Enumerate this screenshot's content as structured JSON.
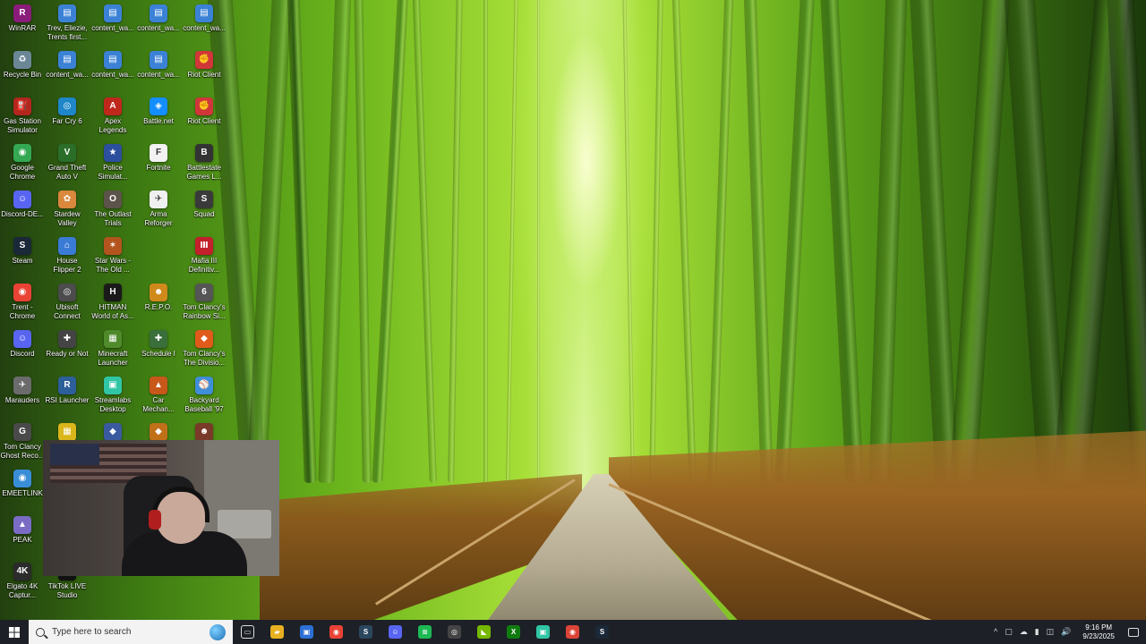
{
  "desktop": {
    "icons": [
      {
        "label": "WinRAR",
        "glyph": "R",
        "color": "#8a1c7a"
      },
      {
        "label": "Trev, Eliezie,\nTrents first...",
        "glyph": "▤",
        "color": "#3b82d6"
      },
      {
        "label": "content_wa...",
        "glyph": "▤",
        "color": "#3b82d6"
      },
      {
        "label": "content_wa...",
        "glyph": "▤",
        "color": "#3b82d6"
      },
      {
        "label": "content_wa...",
        "glyph": "▤",
        "color": "#3b82d6"
      },
      {
        "label": "Recycle Bin",
        "glyph": "♻",
        "color": "#6b8796"
      },
      {
        "label": "content_wa...",
        "glyph": "▤",
        "color": "#3b82d6"
      },
      {
        "label": "content_wa...",
        "glyph": "▤",
        "color": "#3b82d6"
      },
      {
        "label": "content_wa...",
        "glyph": "▤",
        "color": "#3b82d6"
      },
      {
        "label": "Riot Client",
        "glyph": "✊",
        "color": "#d13639"
      },
      {
        "label": "Gas Station\nSimulator",
        "glyph": "⛽",
        "color": "#b3261e"
      },
      {
        "label": "Far Cry 6",
        "glyph": "◎",
        "color": "#1e86c9"
      },
      {
        "label": "Apex\nLegends",
        "glyph": "A",
        "color": "#c0271b"
      },
      {
        "label": "Battle.net",
        "glyph": "◈",
        "color": "#148eff"
      },
      {
        "label": "Riot Client",
        "glyph": "✊",
        "color": "#d13639"
      },
      {
        "label": "Google\nChrome",
        "glyph": "◉",
        "color": "#34a853"
      },
      {
        "label": "Grand Theft\nAuto V",
        "glyph": "V",
        "color": "#2a6e2a"
      },
      {
        "label": "Police\nSimulat...",
        "glyph": "★",
        "color": "#2c4f9e"
      },
      {
        "label": "Fortnite",
        "glyph": "F",
        "color": "#f2f2f2"
      },
      {
        "label": "Battlestate\nGames L...",
        "glyph": "B",
        "color": "#333333"
      },
      {
        "label": "Discord-DE...",
        "glyph": "☺",
        "color": "#5865f2"
      },
      {
        "label": "Stardew\nValley",
        "glyph": "✿",
        "color": "#d9883c"
      },
      {
        "label": "The Outlast\nTrials",
        "glyph": "O",
        "color": "#5c534a"
      },
      {
        "label": "Arma\nReforger",
        "glyph": "✈",
        "color": "#f0f0f0"
      },
      {
        "label": "Squad",
        "glyph": "S",
        "color": "#3a3a3a"
      },
      {
        "label": "Steam",
        "glyph": "S",
        "color": "#1b2838"
      },
      {
        "label": "House\nFlipper 2",
        "glyph": "⌂",
        "color": "#3a7bd5"
      },
      {
        "label": "Star Wars -\nThe Old ...",
        "glyph": "✶",
        "color": "#b3541e"
      },
      {
        "label": "",
        "glyph": "",
        "color": "transparent"
      },
      {
        "label": "Mafia III\nDefinitiv...",
        "glyph": "Ⅲ",
        "color": "#c41f2d"
      },
      {
        "label": "Trent -\nChrome",
        "glyph": "◉",
        "color": "#ea4335"
      },
      {
        "label": "Ubisoft\nConnect",
        "glyph": "◎",
        "color": "#4c4c4c"
      },
      {
        "label": "HITMAN\nWorld of As...",
        "glyph": "H",
        "color": "#1a1a1a"
      },
      {
        "label": "R.E.P.O.",
        "glyph": "☻",
        "color": "#d08a1b"
      },
      {
        "label": "Tom Clancy's\nRainbow Si...",
        "glyph": "6",
        "color": "#555555"
      },
      {
        "label": "Discord",
        "glyph": "☺",
        "color": "#5865f2"
      },
      {
        "label": "Ready or Not",
        "glyph": "✚",
        "color": "#444444"
      },
      {
        "label": "Minecraft\nLauncher",
        "glyph": "▦",
        "color": "#4f8a2b"
      },
      {
        "label": "Schedule I",
        "glyph": "✚",
        "color": "#3a6e3a"
      },
      {
        "label": "Tom Clancy's\nThe Divisio...",
        "glyph": "◆",
        "color": "#e05a1a"
      },
      {
        "label": "Marauders",
        "glyph": "✈",
        "color": "#6b6b6b"
      },
      {
        "label": "RSI Launcher",
        "glyph": "R",
        "color": "#2d5f9a"
      },
      {
        "label": "Streamlabs\nDesktop",
        "glyph": "▣",
        "color": "#30c6a5"
      },
      {
        "label": "Car\nMechan...",
        "glyph": "▲",
        "color": "#c8571a"
      },
      {
        "label": "Backyard\nBaseball '97",
        "glyph": "⚾",
        "color": "#3f8ed8"
      },
      {
        "label": "Tom Clancy\nGhost Reco...",
        "glyph": "G",
        "color": "#4a4a4a"
      },
      {
        "label": "",
        "glyph": "▦",
        "color": "#d9b61a"
      },
      {
        "label": "",
        "glyph": "◆",
        "color": "#3a5aa0"
      },
      {
        "label": "",
        "glyph": "◆",
        "color": "#c07018"
      },
      {
        "label": "",
        "glyph": "☻",
        "color": "#7a3a2a"
      },
      {
        "label": "EMEETLINK",
        "glyph": "◉",
        "color": "#3a8ed8"
      },
      {
        "label": "PEAK",
        "glyph": "▲",
        "color": "#7a6cc4"
      },
      {
        "label": "Elgato 4K\nCaptur...",
        "glyph": "4K",
        "color": "#2b2b2b"
      },
      {
        "label": "TikTok LIVE\nStudio",
        "glyph": "♪",
        "color": "#111111"
      }
    ]
  },
  "taskbar": {
    "search_placeholder": "Type here to search",
    "apps": [
      {
        "name": "task-view",
        "glyph": "▭",
        "color": "transparent"
      },
      {
        "name": "file-explorer",
        "glyph": "▰",
        "color": "#e8b020"
      },
      {
        "name": "app-blue",
        "glyph": "▣",
        "color": "#2d6fd6"
      },
      {
        "name": "chrome",
        "glyph": "◉",
        "color": "#ea4335"
      },
      {
        "name": "steam",
        "glyph": "S",
        "color": "#2a475e"
      },
      {
        "name": "discord",
        "glyph": "☺",
        "color": "#5865f2"
      },
      {
        "name": "spotify",
        "glyph": "≋",
        "color": "#1db954"
      },
      {
        "name": "obs",
        "glyph": "◎",
        "color": "#444444"
      },
      {
        "name": "nvidia",
        "glyph": "◣",
        "color": "#76b900"
      },
      {
        "name": "xbox",
        "glyph": "X",
        "color": "#107c10"
      },
      {
        "name": "streamlabs",
        "glyph": "▣",
        "color": "#30c6a5"
      },
      {
        "name": "chrome-profile",
        "glyph": "◉",
        "color": "#db4437"
      },
      {
        "name": "steam-active",
        "glyph": "S",
        "color": "#1b2838"
      }
    ],
    "tray_icons": [
      "^",
      "▢",
      "☁",
      "▮",
      "◫",
      "🔊"
    ],
    "time": "9:16 PM",
    "date": "9/23/2025"
  }
}
